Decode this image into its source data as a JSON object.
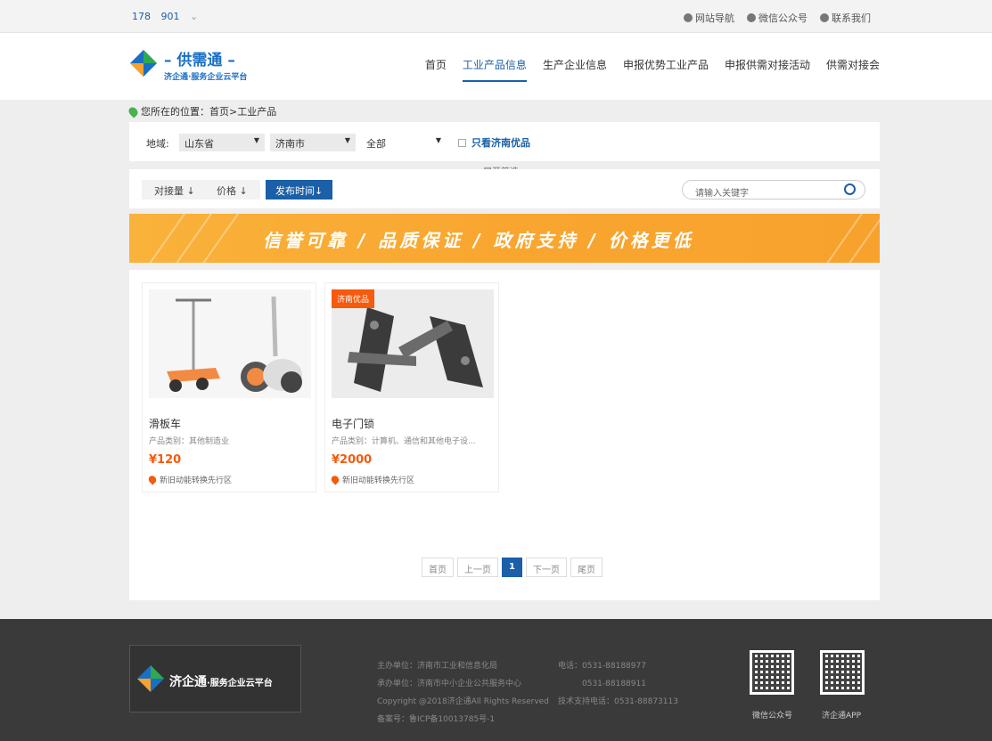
{
  "topbar": {
    "user_a": "178",
    "user_b": "901",
    "chev": "⌄",
    "links": [
      "网站导航",
      "微信公众号",
      "联系我们"
    ]
  },
  "header": {
    "logo_title": "– 供需通 –",
    "logo_sub": "济企通·服务企业云平台",
    "nav": [
      "首页",
      "工业产品信息",
      "生产企业信息",
      "申报优势工业产品",
      "申报供需对接活动",
      "供需对接会"
    ]
  },
  "breadcrumb": "您所在的位置：首页>工业产品",
  "filter": {
    "region_label": "地域:",
    "province": "山东省",
    "city": "济南市",
    "district": "全部",
    "only_label": "只看济南优品",
    "expand": "展开筛选 ⌄"
  },
  "sort": {
    "items": [
      "对接量 ↓",
      "价格 ↓",
      "发布时间↓"
    ],
    "search_placeholder": "请输入关键字"
  },
  "banner": {
    "slogan": "信誉可靠 / 品质保证 / 政府支持 / 价格更低"
  },
  "products": [
    {
      "name": "滑板车",
      "category": "产品类别：其他制造业",
      "price": "¥120",
      "location": "新旧动能转换先行区",
      "badge": ""
    },
    {
      "name": "电子门锁",
      "category": "产品类别：计算机、通信和其他电子设...",
      "price": "¥2000",
      "location": "新旧动能转换先行区",
      "badge": "济南优品"
    }
  ],
  "pager": [
    "首页",
    "上一页",
    "1",
    "下一页",
    "尾页"
  ],
  "footer": {
    "logo_text": "济企通",
    "logo_sub": "·服务企业云平台",
    "host": "主办单位：济南市工业和信息化局",
    "organizer": "承办单位：济南市中小企业公共服务中心",
    "copyright": "Copyright @2018济企通All Rights Reserved",
    "icp": "备案号：鲁ICP备10013785号-1",
    "phone1": "电话：0531-88188977",
    "phone2": "0531-88188911",
    "support": "技术支持电话：0531-88873113",
    "qr1_label": "微信公众号",
    "qr2_label": "济企通APP"
  },
  "colors": {
    "brand": "#1a5fa8",
    "accent": "#f55a0e",
    "banner": "#f9a630"
  }
}
